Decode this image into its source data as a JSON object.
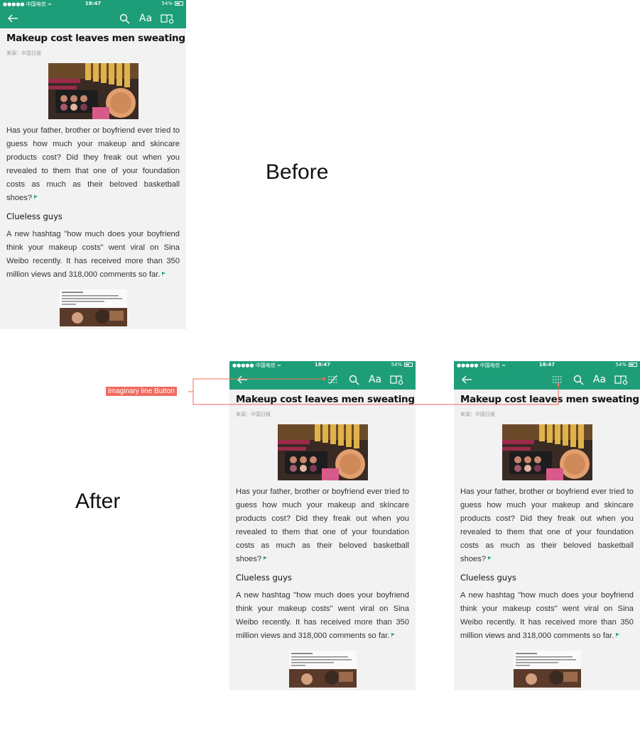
{
  "labels": {
    "before": "Before",
    "after": "After"
  },
  "annotation": {
    "label": "Imaginary line Button",
    "color": "#f06a5e"
  },
  "colors": {
    "accent": "#1e9e78",
    "background": "#f2f2f2"
  },
  "status": {
    "carrier": "●●●●● 中国电信 ≈",
    "time": "18:47",
    "battery": "54%"
  },
  "nav_icons": [
    "back-arrow-icon",
    "imaginary-line-icon",
    "search-icon",
    "font-size-icon",
    "bookmark-book-icon"
  ],
  "font_button_label": "Aa",
  "article": {
    "title": "Makeup cost leaves men sweating",
    "source": "来源：中国日报",
    "paragraph1": "Has your father, brother or boyfriend ever tried to guess how much your makeup and skincare products cost? Did they freak out when you revealed to them that one of your foundation costs as much as their beloved basketball shoes?",
    "subheading": "Clueless guys",
    "paragraph2": "A new hashtag \"how much does your boyfriend think your makeup costs\" went viral on Sina Weibo recently. It has received more than 350 million views and 318,000 comments so far."
  }
}
